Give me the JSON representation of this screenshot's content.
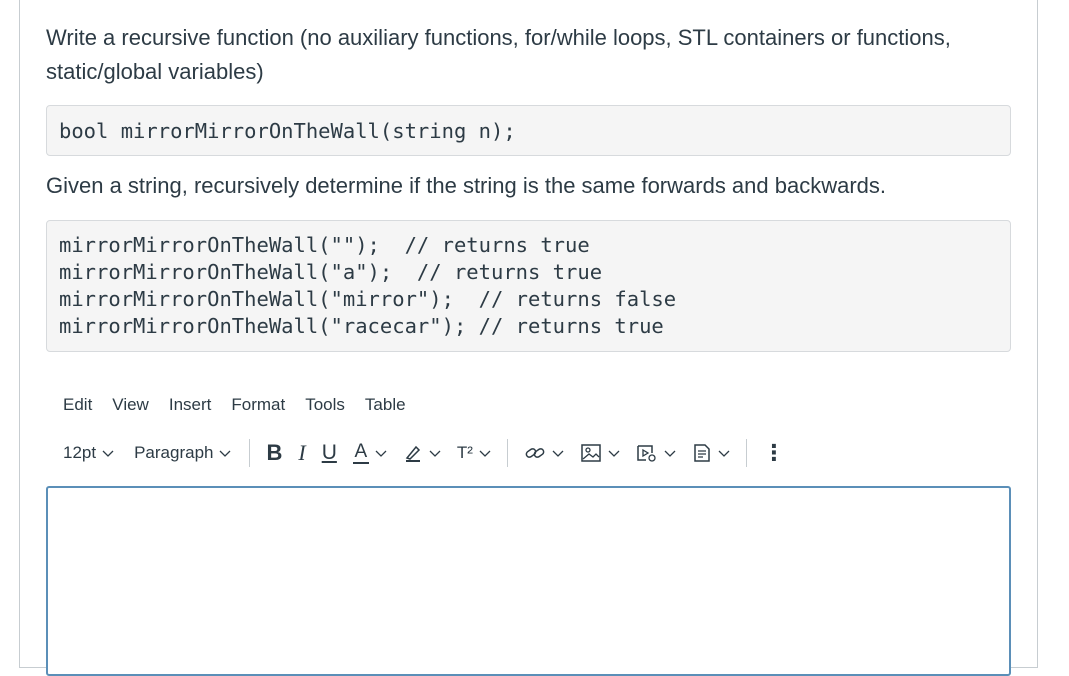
{
  "question": {
    "prompt": "Write a recursive function (no auxiliary functions, for/while loops, STL containers or functions, static/global variables)",
    "signature": "bool mirrorMirrorOnTheWall(string n);",
    "description": "Given a string, recursively determine if the string is the same forwards and backwards.",
    "examples": [
      "mirrorMirrorOnTheWall(\"\");  // returns true",
      "mirrorMirrorOnTheWall(\"a\");  // returns true",
      "mirrorMirrorOnTheWall(\"mirror\");  // returns false",
      "mirrorMirrorOnTheWall(\"racecar\"); // returns true"
    ]
  },
  "editor": {
    "menu": [
      "Edit",
      "View",
      "Insert",
      "Format",
      "Tools",
      "Table"
    ],
    "font_size": "12pt",
    "block_format": "Paragraph",
    "bold_label": "B",
    "italic_label": "I",
    "underline_label": "U",
    "text_color_label": "A",
    "superscript_label": "T²",
    "more_label": "⋮",
    "content": ""
  },
  "colors": {
    "text": "#2d3b45",
    "code_bg": "#f5f5f5",
    "border": "#c7cdd1",
    "focus": "#5b8fb8"
  }
}
